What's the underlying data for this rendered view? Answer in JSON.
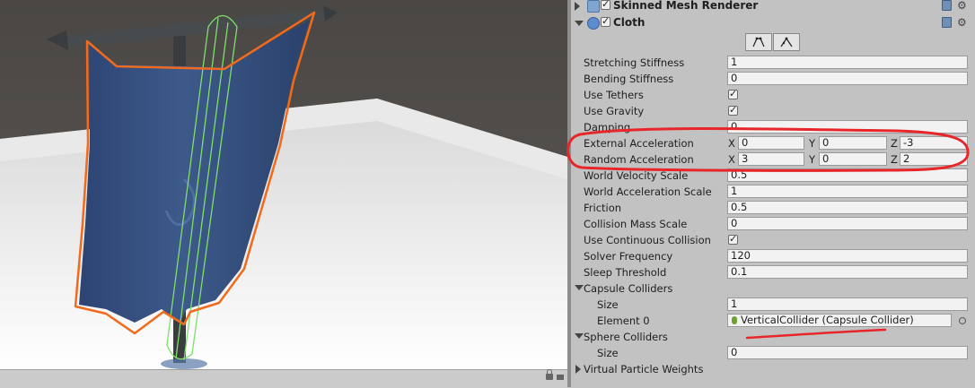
{
  "components": {
    "skinned_mesh_renderer": {
      "title": "Skinned Mesh Renderer"
    },
    "cloth": {
      "title": "Cloth"
    }
  },
  "properties": {
    "stretching_stiffness": {
      "label": "Stretching Stiffness",
      "value": "1"
    },
    "bending_stiffness": {
      "label": "Bending Stiffness",
      "value": "0"
    },
    "use_tethers": {
      "label": "Use Tethers",
      "checked": true
    },
    "use_gravity": {
      "label": "Use Gravity",
      "checked": true
    },
    "damping": {
      "label": "Damping",
      "value": "0"
    },
    "external_acceleration": {
      "label": "External Acceleration",
      "x_label": "X",
      "x": "0",
      "y_label": "Y",
      "y": "0",
      "z_label": "Z",
      "z": "-3"
    },
    "random_acceleration": {
      "label": "Random Acceleration",
      "x_label": "X",
      "x": "3",
      "y_label": "Y",
      "y": "0",
      "z_label": "Z",
      "z": "2"
    },
    "world_velocity_scale": {
      "label": "World Velocity Scale",
      "value": "0.5"
    },
    "world_acceleration_scale": {
      "label": "World Acceleration Scale",
      "value": "1"
    },
    "friction": {
      "label": "Friction",
      "value": "0.5"
    },
    "collision_mass_scale": {
      "label": "Collision Mass Scale",
      "value": "0"
    },
    "use_continuous_collision": {
      "label": "Use Continuous Collision",
      "checked": true
    },
    "solver_frequency": {
      "label": "Solver Frequency",
      "value": "120"
    },
    "sleep_threshold": {
      "label": "Sleep Threshold",
      "value": "0.1"
    }
  },
  "capsule_colliders": {
    "label": "Capsule Colliders",
    "size_label": "Size",
    "size": "1",
    "element0_label": "Element 0",
    "element0": "VerticalCollider (Capsule Collider)"
  },
  "sphere_colliders": {
    "label": "Sphere Colliders",
    "size_label": "Size",
    "size": "0"
  },
  "virtual_particle_weights": {
    "label": "Virtual Particle Weights"
  },
  "colors": {
    "selection_outline": "#f26a1b",
    "annotation_red": "#e8262a",
    "collider_green": "#7ee06a",
    "cloth_blue": "#35507f",
    "inspector_bg": "#c2c2c2"
  }
}
